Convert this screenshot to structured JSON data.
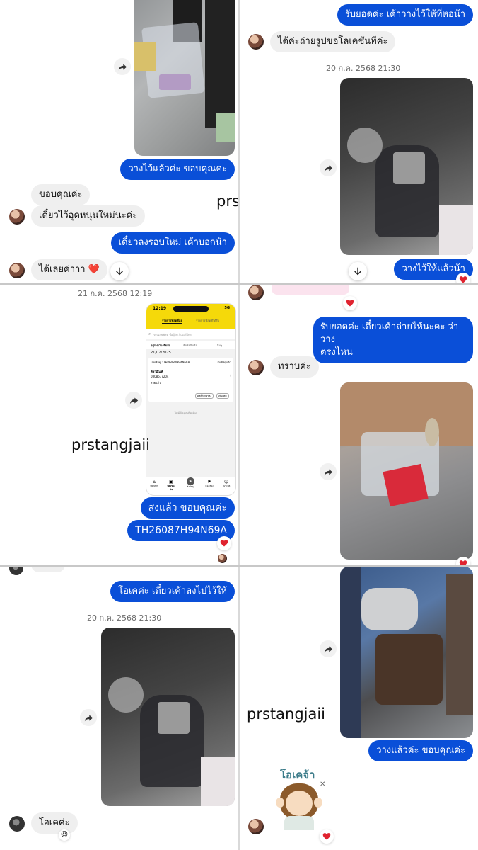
{
  "watermark": "prstangjaii",
  "panel1": {
    "left": {
      "sent_placed": "วางไว้แล้วค่ะ ขอบคุณค่ะ",
      "recv_thanks": "ขอบคุณค่ะ",
      "recv_heat": "เดี๋ยวไว้อุดหนุนใหม่นะค่ะ",
      "sent_round": "เดี๋ยวลงรอบใหม่ เค้าบอกน้า",
      "recv_ok": "ได้เลยค่าาา ❤️"
    },
    "right": {
      "sent_top": "รับยอดค่ะ เค้าวางไว้ให้ที่หอน้า",
      "recv_photo": "ได้ค่ะถ่ายรูปขอโลเคชั่นทีค่ะ",
      "timestamp": "20 ก.ค. 2568 21:30",
      "sent_placed": "วางไว้ให้แล้วน้า"
    }
  },
  "panel2": {
    "left": {
      "timestamp": "21 ก.ค. 2568 12:19",
      "sent_shipped": "ส่งแล้ว ขอบคุณค่ะ",
      "sent_tracking": "TH26087H94N69A",
      "phone": {
        "time": "12:19",
        "signal": "5G",
        "tab_active": "รายการพัสดุที่ส่ง",
        "tab_other": "รายการพัสดุที่ได้รับ",
        "search_placeholder": "ระบุเลขพัสดุ ชื่อผู้รับ / เบอร์โทร",
        "filter1": "อยู่ระหว่างจัดส่ง",
        "filter2": "จัดส่งสำเร็จ",
        "filter3": "อื่นๆ",
        "date": "21/07/2025",
        "tracking_label": "เลขพัสดุ : TH26087H94N69A",
        "status": "รับพัสดุแล้ว",
        "recipient_name": "พิชามัณฑ์",
        "recipient_phone": "0808677204",
        "recipient_area": "สายแก้ว",
        "btn_detail": "ดูสติ๊กเกอร์ส่ง",
        "btn_more": "เพิ่มเติม",
        "empty_text": "ไม่มีข้อมูลเพิ่มเติม",
        "nav": [
          "หน้าหลัก",
          "พัสดุของฉัน",
          "ส่งพัสดุ",
          "แจงเรื่อง",
          "โปรไฟล์"
        ]
      }
    },
    "right": {
      "sent_confirm_1": "รับยอดค่ะ เดี๋ยวเค้าถ่ายให้นะคะ ว่าวาง",
      "sent_confirm_2": "ตรงไหน",
      "recv_ack": "ทราบค่ะ"
    }
  },
  "panel3": {
    "left": {
      "sent_ok": "โอเคค่ะ เดี๋ยวเค้าลงไปไว้ให้",
      "timestamp": "20 ก.ค. 2568 21:30",
      "recv_ok": "โอเคค่ะ"
    },
    "right": {
      "sent_placed": "วางแล้วค่ะ ขอบคุณค่ะ",
      "sticker_text": "โอเคจ้า"
    }
  },
  "colors": {
    "outgoing_bubble": "#0a4fd8",
    "incoming_bubble": "#efefef",
    "heart": "#e0232f",
    "app_yellow": "#f5d90a"
  }
}
